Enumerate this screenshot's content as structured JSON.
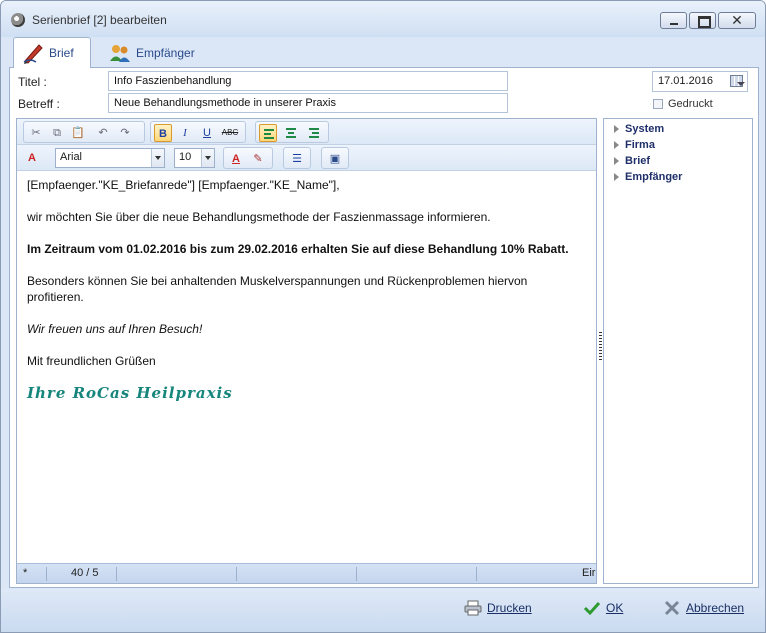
{
  "window": {
    "title": "Serienbrief [2] bearbeiten"
  },
  "tabs": [
    {
      "label": "Brief",
      "active": true
    },
    {
      "label": "Empfänger",
      "active": false
    }
  ],
  "form": {
    "titel_label": "Titel :",
    "titel_value": "Info Faszienbehandlung",
    "betreff_label": "Betreff :",
    "betreff_value": "Neue Behandlungsmethode in unserer Praxis",
    "date_value": "17.01.2016",
    "gedruckt_label": "Gedruckt"
  },
  "toolbar": {
    "font_value": "Arial",
    "size_value": "10",
    "bold_glyph": "B",
    "italic_glyph": "I",
    "underline_glyph": "U",
    "strike_glyph": "ABC"
  },
  "document": {
    "line1": "[Empfaenger.\"KE_Briefanrede\"] [Empfaenger.\"KE_Name\"],",
    "line2": "wir möchten Sie über die neue Behandlungsmethode der Faszienmassage informieren.",
    "line3": "Im Zeitraum vom 01.02.2016 bis zum 29.02.2016 erhalten Sie auf diese Behandlung 10% Rabatt.",
    "line4": "Besonders können Sie bei anhaltenden Muskelverspannungen und Rückenproblemen hiervon profitieren.",
    "line5": "Wir freuen uns auf Ihren Besuch!",
    "line6": "Mit freundlichen Grüßen",
    "signature": "Ihre RoCas Heilpraxis"
  },
  "statusbar": {
    "marker": "*",
    "position": "40 / 5",
    "mode": "Eir"
  },
  "tree": {
    "items": [
      "System",
      "Firma",
      "Brief",
      "Empfänger"
    ]
  },
  "footer": {
    "print_label": "Drucken",
    "ok_label": "OK",
    "cancel_label": "Abbrechen"
  },
  "colors": {
    "accent": "#2a4a8a",
    "signature": "#16857c",
    "ok": "#2e9a2e",
    "cancel": "#7a8597"
  }
}
